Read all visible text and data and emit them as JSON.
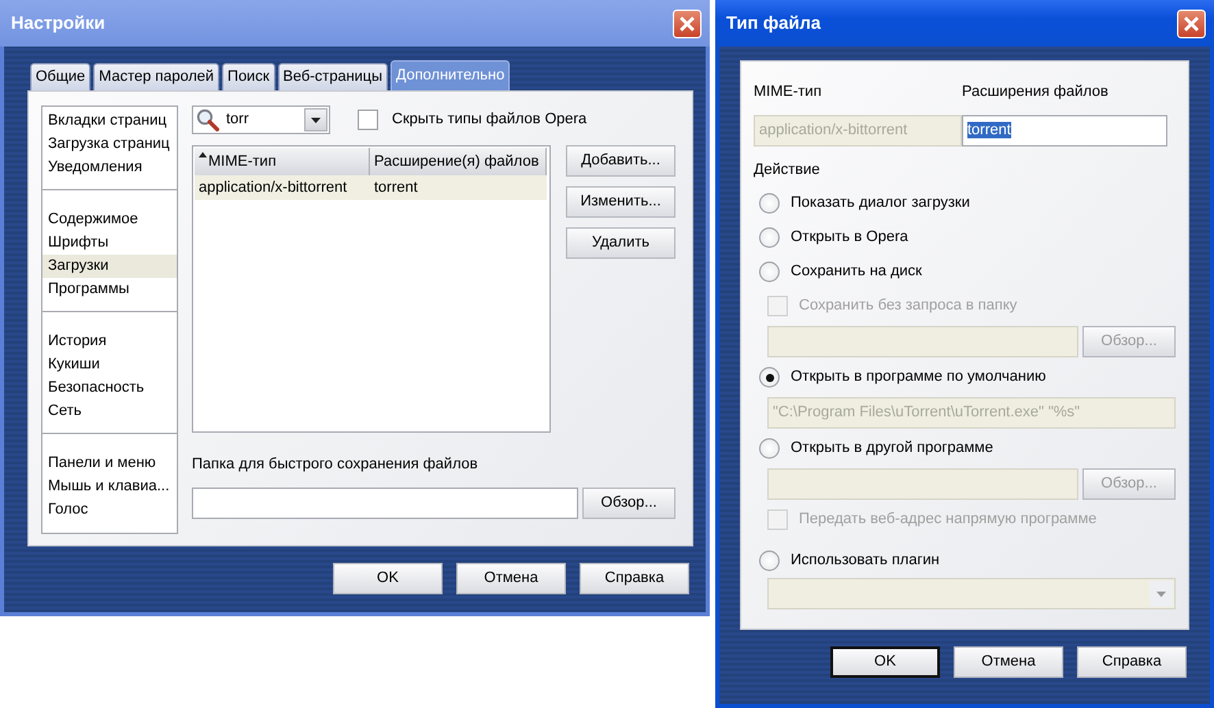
{
  "settings_window": {
    "title": "Настройки",
    "active": false,
    "tabs": [
      {
        "label": "Общие",
        "selected": false
      },
      {
        "label": "Мастер паролей",
        "selected": false
      },
      {
        "label": "Поиск",
        "selected": false
      },
      {
        "label": "Веб-страницы",
        "selected": false
      },
      {
        "label": "Дополнительно",
        "selected": true
      }
    ],
    "sidebar": {
      "groups": [
        [
          {
            "label": "Вкладки страниц",
            "selected": false
          },
          {
            "label": "Загрузка страниц",
            "selected": false
          },
          {
            "label": "Уведомления",
            "selected": false
          }
        ],
        [
          {
            "label": "Содержимое",
            "selected": false
          },
          {
            "label": "Шрифты",
            "selected": false
          },
          {
            "label": "Загрузки",
            "selected": true
          },
          {
            "label": "Программы",
            "selected": false
          }
        ],
        [
          {
            "label": "История",
            "selected": false
          },
          {
            "label": "Кукиши",
            "selected": false
          },
          {
            "label": "Безопасность",
            "selected": false
          },
          {
            "label": "Сеть",
            "selected": false
          }
        ],
        [
          {
            "label": "Панели и меню",
            "selected": false
          },
          {
            "label": "Мышь и клавиа...",
            "selected": false
          },
          {
            "label": "Голос",
            "selected": false
          }
        ]
      ]
    },
    "filter": {
      "value": "torr"
    },
    "hide_opera_types": {
      "label": "Скрыть типы файлов Opera",
      "checked": false
    },
    "table": {
      "columns": [
        {
          "label": "MIME-тип",
          "sorted": true
        },
        {
          "label": "Расширение(я) файлов",
          "sorted": false
        }
      ],
      "rows": [
        {
          "cells": [
            "application/x-bittorrent",
            "torrent"
          ],
          "selected": true
        }
      ]
    },
    "side_buttons": [
      "Добавить...",
      "Изменить...",
      "Удалить"
    ],
    "folder": {
      "label": "Папка для быстрого сохранения файлов",
      "browse": "Обзор..."
    },
    "buttons": [
      {
        "label": "OK",
        "default": false
      },
      {
        "label": "Отмена",
        "default": false
      },
      {
        "label": "Справка",
        "default": false
      }
    ]
  },
  "file_type_window": {
    "title": "Тип файла",
    "active": true,
    "mime_label": "MIME-тип",
    "mime_value": "application/x-bittorrent",
    "ext_label": "Расширения файлов",
    "ext_value": "torrent",
    "ext_text_selected": true,
    "action_label": "Действие",
    "actions": [
      {
        "kind": "radio",
        "label": "Показать диалог загрузки",
        "selected": false
      },
      {
        "kind": "radio",
        "label": "Открыть в Opera",
        "selected": false
      },
      {
        "kind": "radio",
        "label": "Сохранить на диск",
        "selected": false
      },
      {
        "kind": "checkbox",
        "label": "Сохранить без запроса в папку",
        "checked": false,
        "disabled": true
      },
      {
        "kind": "path",
        "browse": "Обзор...",
        "disabled": true
      },
      {
        "kind": "radio",
        "label": "Открыть в программе по умолчанию",
        "selected": true
      },
      {
        "kind": "path",
        "value": "\"C:\\Program Files\\uTorrent\\uTorrent.exe\" \"%s\"",
        "disabled": true
      },
      {
        "kind": "radio",
        "label": "Открыть в другой программе",
        "selected": false
      },
      {
        "kind": "path",
        "browse": "Обзор...",
        "disabled": true
      },
      {
        "kind": "checkbox",
        "label": "Передать веб-адрес напрямую программе",
        "checked": false,
        "disabled": true
      },
      {
        "kind": "radio",
        "label": "Использовать плагин",
        "selected": false
      },
      {
        "kind": "combo",
        "disabled": true
      }
    ],
    "buttons": [
      {
        "label": "OK",
        "default": true
      },
      {
        "label": "Отмена",
        "default": false
      },
      {
        "label": "Справка",
        "default": false
      }
    ]
  }
}
